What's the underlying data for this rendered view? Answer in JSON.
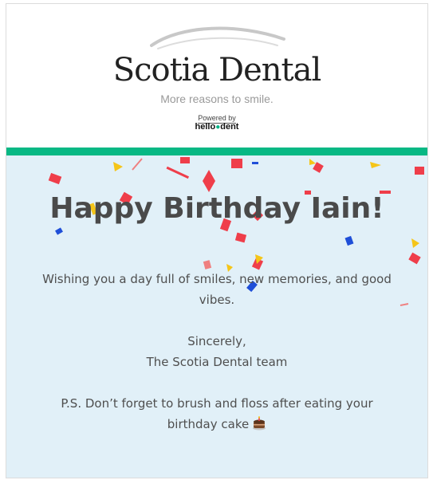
{
  "brand": {
    "name": "Scotia Dental",
    "tagline": "More reasons to smile.",
    "powered_by_label": "Powered by",
    "platform_name_part1": "hello",
    "platform_name_part2": "dent"
  },
  "email": {
    "headline": "Happy Birthday Iain!",
    "wish_line_1": "Wishing you a day full of smiles, new memories, and good",
    "wish_line_2": "vibes.",
    "signoff": "Sincerely,",
    "signature": "The Scotia Dental team",
    "ps_line_1": "P.S. Don’t forget to brush and floss after eating your",
    "ps_line_2": "birthday cake"
  },
  "colors": {
    "accent_green": "#08b884",
    "body_background": "#e1f0f8",
    "headline_text": "#4a4a4a",
    "confetti": [
      "#ef3e4a",
      "#f5c518",
      "#1f4fd8"
    ]
  },
  "icons": {
    "cake": "cake-icon",
    "logo_swoosh": "swoosh-icon",
    "tooth": "tooth-icon"
  }
}
